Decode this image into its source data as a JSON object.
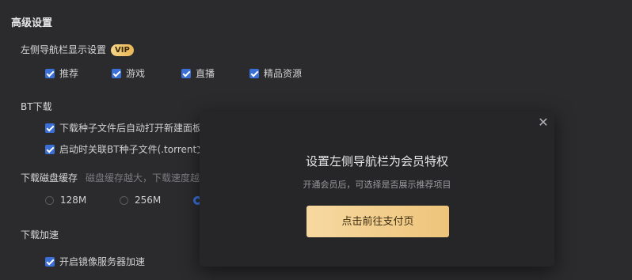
{
  "section_title": "高级设置",
  "sidebar_display": {
    "label": "左侧导航栏显示设置",
    "vip_badge": "VIP",
    "options": [
      {
        "label": "推荐",
        "checked": true
      },
      {
        "label": "游戏",
        "checked": true
      },
      {
        "label": "直播",
        "checked": true
      },
      {
        "label": "精品资源",
        "checked": true
      }
    ]
  },
  "bt_download": {
    "label": "BT下载",
    "options": [
      {
        "label": "下载种子文件后自动打开新建面板",
        "checked": true
      },
      {
        "label": "启动时关联BT种子文件(.torrent文",
        "checked": true
      }
    ]
  },
  "disk_cache": {
    "label": "下载磁盘缓存",
    "hint": "磁盘缓存越大，下载速度越",
    "options": [
      {
        "label": "128M",
        "selected": false
      },
      {
        "label": "256M",
        "selected": false
      },
      {
        "label": "",
        "selected": true
      }
    ]
  },
  "download_accel": {
    "label": "下载加速",
    "options": [
      {
        "label": "开启镜像服务器加速",
        "checked": true
      }
    ]
  },
  "modal": {
    "close_icon": "close-icon",
    "title": "设置左侧导航栏为会员特权",
    "description": "开通会员后，可选择是否展示推荐项目",
    "button_label": "点击前往支付页"
  }
}
